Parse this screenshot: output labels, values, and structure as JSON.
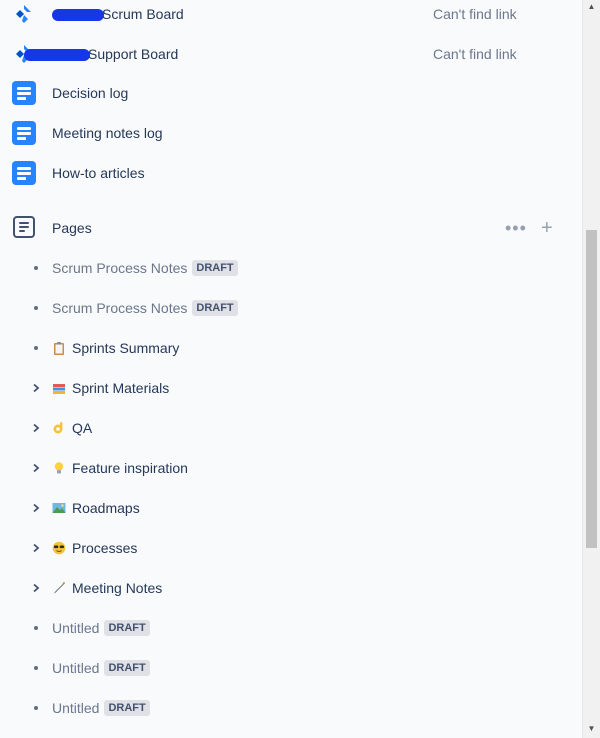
{
  "shortcuts": [
    {
      "label": "Scrum Board",
      "meta": "Can't find link",
      "icon": "jira-board-icon"
    },
    {
      "label": "Support Board",
      "meta": "Can't find link",
      "icon": "jira-board-icon"
    },
    {
      "label": "Decision log",
      "icon": "document-icon"
    },
    {
      "label": "Meeting notes log",
      "icon": "document-icon"
    },
    {
      "label": "How-to articles",
      "icon": "document-icon"
    }
  ],
  "pages_section": {
    "label": "Pages",
    "more": "•••",
    "add": "+"
  },
  "pages": [
    {
      "label": "Scrum Process Notes",
      "badge": "DRAFT",
      "emoji": ""
    },
    {
      "label": "Scrum Process Notes",
      "badge": "DRAFT",
      "emoji": ""
    },
    {
      "label": "Sprints Summary",
      "emoji": "clipboard"
    },
    {
      "label": "Sprint Materials",
      "emoji": "books"
    },
    {
      "label": "QA",
      "emoji": "ok-hand"
    },
    {
      "label": "Feature inspiration",
      "emoji": "light-bulb"
    },
    {
      "label": "Roadmaps",
      "emoji": "map-picture"
    },
    {
      "label": "Processes",
      "emoji": "cool-face"
    },
    {
      "label": "Meeting Notes",
      "emoji": "pen"
    },
    {
      "label": "Untitled",
      "badge": "DRAFT",
      "emoji": ""
    },
    {
      "label": "Untitled",
      "badge": "DRAFT",
      "emoji": ""
    },
    {
      "label": "Untitled",
      "badge": "DRAFT",
      "emoji": ""
    }
  ],
  "colors": {
    "brand": "#2684ff",
    "redaction": "#1537e6",
    "panel": "#f9fafc"
  }
}
